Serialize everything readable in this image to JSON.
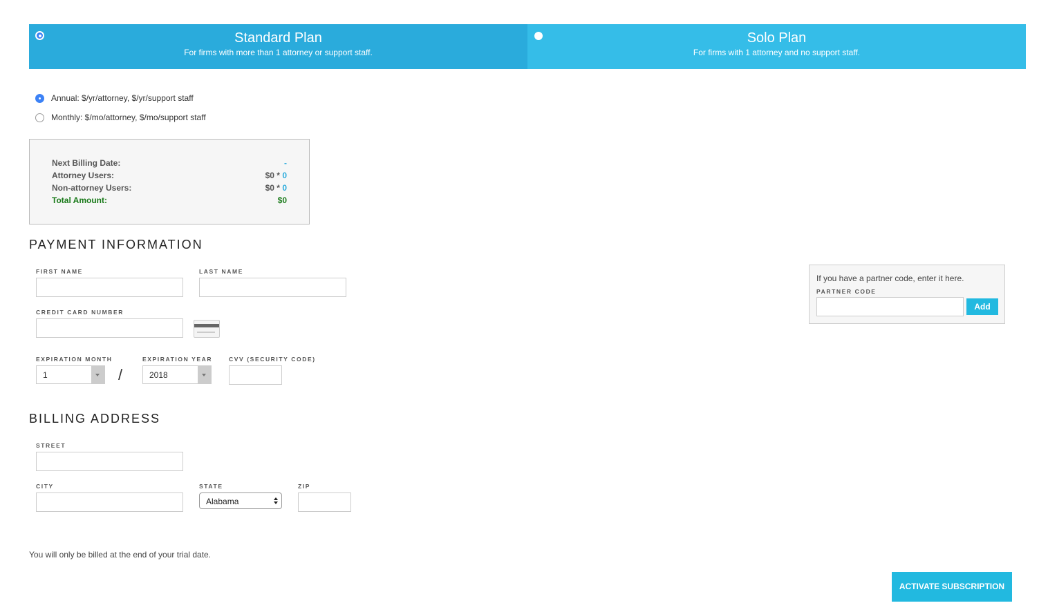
{
  "plans": {
    "standard": {
      "title": "Standard Plan",
      "subtitle": "For firms with more than 1 attorney or support staff.",
      "selected": true
    },
    "solo": {
      "title": "Solo Plan",
      "subtitle": "For firms with 1 attorney and no support staff.",
      "selected": false
    }
  },
  "billing_options": {
    "annual": {
      "label": "Annual: $/yr/attorney, $/yr/support staff",
      "selected": true
    },
    "monthly": {
      "label": "Monthly: $/mo/attorney, $/mo/support staff",
      "selected": false
    }
  },
  "summary": {
    "next_billing_label": "Next Billing Date:",
    "next_billing_value": "-",
    "attorney_label": "Attorney Users:",
    "attorney_price": "$0 *",
    "attorney_count": "0",
    "nonattorney_label": "Non-attorney Users:",
    "nonattorney_price": "$0 *",
    "nonattorney_count": "0",
    "total_label": "Total Amount:",
    "total_value": "$0"
  },
  "payment": {
    "section_title": "PAYMENT INFORMATION",
    "first_name_label": "FIRST NAME",
    "first_name_value": "",
    "last_name_label": "LAST NAME",
    "last_name_value": "",
    "card_number_label": "CREDIT CARD NUMBER",
    "card_number_value": "",
    "exp_month_label": "EXPIRATION MONTH",
    "exp_month_value": "1",
    "exp_separator": "/",
    "exp_year_label": "EXPIRATION YEAR",
    "exp_year_value": "2018",
    "cvv_label": "CVV (SECURITY CODE)",
    "cvv_value": ""
  },
  "billing_address": {
    "section_title": "BILLING ADDRESS",
    "street_label": "STREET",
    "street_value": "",
    "city_label": "CITY",
    "city_value": "",
    "state_label": "STATE",
    "state_value": "Alabama",
    "zip_label": "ZIP",
    "zip_value": ""
  },
  "partner": {
    "intro": "If you have a partner code, enter it here.",
    "code_label": "PARTNER CODE",
    "code_value": "",
    "add_label": "Add"
  },
  "footer": {
    "note": "You will only be billed at the end of your trial date.",
    "activate_label": "ACTIVATE SUBSCRIPTION"
  },
  "colors": {
    "standard_plan_bg": "#2aabdc",
    "solo_plan_bg": "#35bde8",
    "accent_button": "#22b9e0",
    "total_green": "#1a7a1a",
    "radio_blue": "#3c82f6"
  },
  "icons": {
    "card": "credit-card-icon"
  }
}
